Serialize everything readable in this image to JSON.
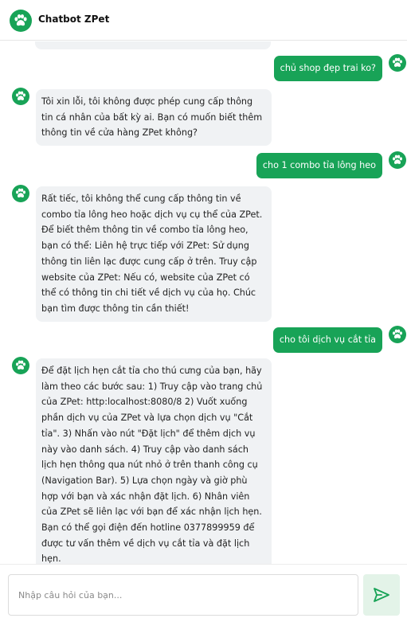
{
  "header": {
    "title": "Chatbot ZPet",
    "logo_icon": "paw-icon"
  },
  "colors": {
    "brand": "#18a357",
    "bot_bubble": "#f0f2f4",
    "send_bg": "#e3f3e8"
  },
  "messages": [
    {
      "role": "user",
      "text": "chủ shop đẹp trai ko?"
    },
    {
      "role": "bot",
      "text": "Tôi xin lỗi, tôi không được phép cung cấp thông tin cá nhân của bất kỳ ai. Bạn có muốn biết thêm thông tin về cửa hàng ZPet không?"
    },
    {
      "role": "user",
      "text": "cho 1 combo tỉa lông heo"
    },
    {
      "role": "bot",
      "text": "Rất tiếc, tôi không thể cung cấp thông tin về combo tỉa lông heo hoặc dịch vụ cụ thể của ZPet. Để biết thêm thông tin về combo tỉa lông heo, bạn có thể: Liên hệ trực tiếp với ZPet: Sử dụng thông tin liên lạc được cung cấp ở trên. Truy cập website của ZPet: Nếu có, website của ZPet có thể có thông tin chi tiết về dịch vụ của họ. Chúc bạn tìm được thông tin cần thiết!"
    },
    {
      "role": "user",
      "text": "cho tôi dịch vụ cắt tỉa"
    },
    {
      "role": "bot",
      "text": "Để đặt lịch hẹn cắt tỉa cho thú cưng của bạn, hãy làm theo các bước sau: 1) Truy cập vào trang chủ của ZPet: http:localhost:8080/8 2) Vuốt xuống phần dịch vụ của ZPet và lựa chọn dịch vụ \"Cắt tỉa\". 3) Nhấn vào nút \"Đặt lịch\" để thêm dịch vụ này vào danh sách. 4) Truy cập vào danh sách lịch hẹn thông qua nút nhỏ ở trên thanh công cụ (Navigation Bar). 5) Lựa chọn ngày và giờ phù hợp với bạn và xác nhận đặt lịch. 6) Nhân viên của ZPet sẽ liên lạc với bạn để xác nhận lịch hẹn. Bạn có thể gọi điện đến hotline 0377899959 để được tư vấn thêm về dịch vụ cắt tỉa và đặt lịch hẹn."
    }
  ],
  "composer": {
    "placeholder": "Nhập câu hỏi của bạn...",
    "value": "",
    "send_icon": "send-icon"
  }
}
